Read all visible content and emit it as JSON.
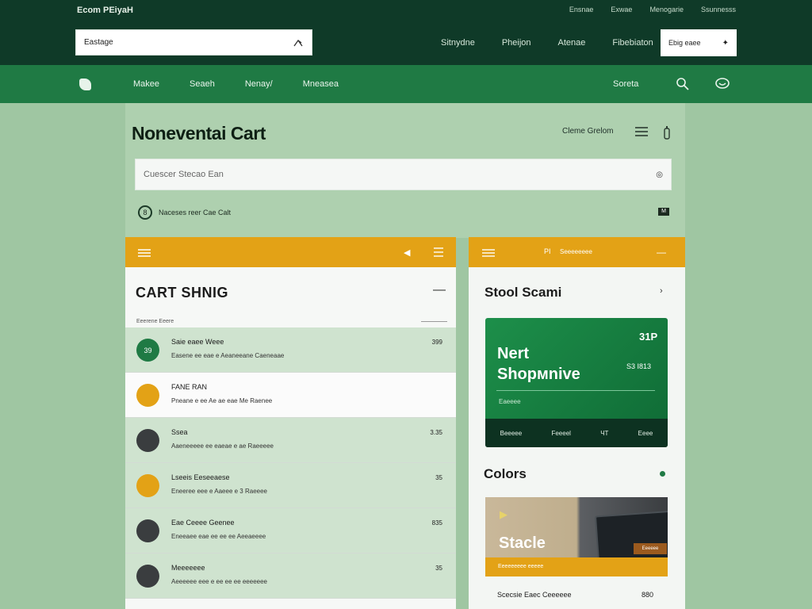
{
  "topbar": {
    "brand": "Ecom PEiyaH",
    "links": [
      "Ensnae",
      "Exwae",
      "Menogarie",
      "Ssunnesss"
    ],
    "search_value": "Eastage",
    "nav": [
      "Sitnydne",
      "Pheijon",
      "Atenae",
      "Fibebiaton"
    ],
    "mini_box_label": "Ebig eaee"
  },
  "navbar": {
    "items": [
      "Makee",
      "Seaeh",
      "Nenay/",
      "Mneasea"
    ],
    "right_label": "Soreta"
  },
  "main": {
    "title": "Noneventai Cart",
    "right_label": "Cleme Grelom",
    "cart_search_placeholder": "Cuescer Stecao Ean",
    "notice_badge": "8",
    "notice_text": "Naceses reer Cae Calt",
    "notice_icon": "M"
  },
  "left_card": {
    "title": "CART SHNIG",
    "subhead": "Eeerene Eeere",
    "items": [
      {
        "badge": "39",
        "name": "Saie eaee Weee",
        "desc": "Easene ee eae e Aeaneeane Caeneaae",
        "price": "399",
        "color": "#1f7a44",
        "style": "alt"
      },
      {
        "badge": "",
        "name": "FANE RAN",
        "desc": "Pneane e ee Ae ae eae Me Raenee",
        "price": "",
        "color": "#e3a216",
        "style": "white"
      },
      {
        "badge": "",
        "name": "Ssea",
        "desc": "Aaeneeeee ee eaeae e ae Raeeeee",
        "price": "3.35",
        "color": "#3a3d3f",
        "style": "alt"
      },
      {
        "badge": "",
        "name": "Lseeis Eeseeaese",
        "desc": "Eneeree eee e Aaeee e 3 Raeeee",
        "price": "35",
        "color": "#e3a216",
        "style": "alt"
      },
      {
        "badge": "",
        "name": "Eae Ceeee Geenee",
        "desc": "Eneeaee eae ee ee ee Aeeaeeee",
        "price": "835",
        "color": "#3a3d3f",
        "style": "alt"
      },
      {
        "badge": "",
        "name": "Meeeeeee",
        "desc": "Aeeeeee eee e ee ee ee eeeeeee",
        "price": "35",
        "color": "#3a3d3f",
        "style": "alt"
      }
    ]
  },
  "right_card": {
    "header_label": "PI",
    "header_label2": "Seeeeeeee",
    "title": "Stool Scami",
    "promo": {
      "number": "31P",
      "title_line1": "Nert",
      "title_line2": "Shopмnive",
      "price": "S3 I813",
      "sub": "Eaeeee",
      "footer": [
        "Beeeee",
        "Feeeel",
        "ЧТ",
        "Eeee"
      ]
    },
    "colors_title": "Colors",
    "product": {
      "name": "Stacle",
      "tag": "Eeeeee",
      "band": "Eeeeeeeee eeeee"
    },
    "bottom_label": "Scecsie Eaec Ceeeeee",
    "bottom_value": "880"
  },
  "colors": {
    "dark_green": "#0f3a28",
    "green": "#1f7a44",
    "sage": "#aed0af",
    "amber": "#e3a216"
  }
}
